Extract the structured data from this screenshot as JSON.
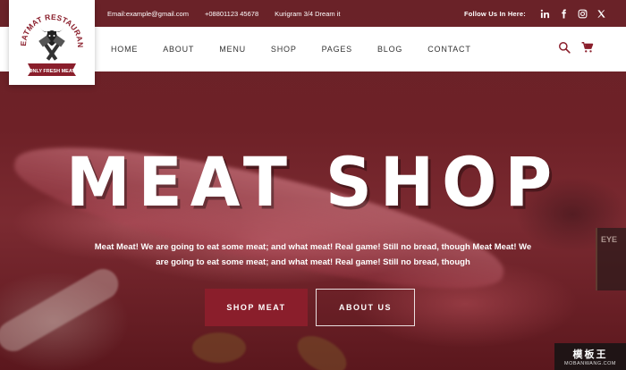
{
  "colors": {
    "accent": "#8a1e2b",
    "overlay": "#6e2127",
    "nav_bg": "#ffffff"
  },
  "logo": {
    "alt": "Meatmat Restaurant Only Fresh Meat"
  },
  "topbar": {
    "email": "Email:example@gmail.com",
    "phone": "+08801123 45678",
    "address": "Kurigram 3/4 Dream it",
    "follow_label": "Follow Us In Here:",
    "social_icons": [
      "linkedin-icon",
      "facebook-icon",
      "instagram-icon",
      "x-twitter-icon"
    ]
  },
  "nav": {
    "items": [
      "HOME",
      "ABOUT",
      "MENU",
      "SHOP",
      "PAGES",
      "BLOG",
      "CONTACT"
    ],
    "tools": [
      "search-icon",
      "cart-icon"
    ]
  },
  "hero": {
    "title": "MEAT SHOP",
    "description": "Meat Meat! We are going to eat some meat; and what meat! Real game! Still no bread, though Meat Meat! We are going to eat some meat; and what meat! Real game! Still no bread, though",
    "primary_button": "SHOP MEAT",
    "secondary_button": "ABOUT US"
  },
  "watermark": {
    "top": "模板王",
    "bottom": "MOBANWANG.COM"
  }
}
